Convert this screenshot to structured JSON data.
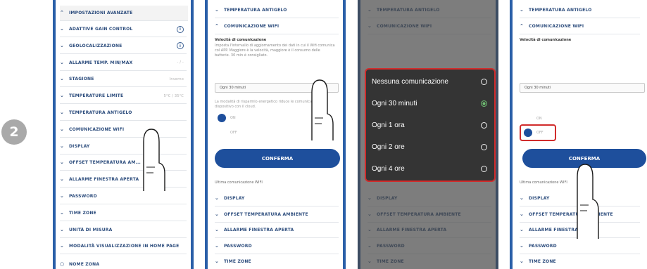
{
  "step_number": "2",
  "screen1": {
    "header": "IMPOSTAZIONI AVANZATE",
    "rows": [
      {
        "label": "ADATTIVE GAIN CONTROL",
        "info": "i"
      },
      {
        "label": "GEOLOCALIZZAZIONE",
        "info": "i"
      },
      {
        "label": "ALLARME TEMP. MIN/MAX",
        "value": "- / -"
      },
      {
        "label": "STAGIONE",
        "value": "Inverno"
      },
      {
        "label": "TEMPERATURE LIMITE",
        "value": "5°C / 35°C"
      },
      {
        "label": "TEMPERATURA ANTIGELO",
        "value": ""
      },
      {
        "label": "COMUNICAZIONE WIFI",
        "value": ""
      },
      {
        "label": "DISPLAY",
        "value": ""
      },
      {
        "label": "OFFSET TEMPERATURA AM...",
        "value": ""
      },
      {
        "label": "ALLARME FINESTRA APERTA",
        "value": ""
      },
      {
        "label": "PASSWORD",
        "value": ""
      },
      {
        "label": "TIME ZONE",
        "value": ""
      },
      {
        "label": "UNITÀ DI MISURA",
        "value": ""
      },
      {
        "label": "MODALITÀ VISUALIZZAZIONE IN HOME PAGE",
        "value": ""
      }
    ],
    "footer": "NOME ZONA"
  },
  "screen2": {
    "row_antigelo": "TEMPERATURA ANTIGELO",
    "row_wifi": "COMUNICAZIONE WIFI",
    "freq_title": "Velocità di comunicazione",
    "freq_desc": "Imposta l'intervallo di aggiornamento dei dati in cui il Wifi comunica col APP. Maggiore è la velocità, maggiore è il consumo delle batterie. 30 min è consigliato.",
    "select_value": "Ogni 30 minuti",
    "toggle_desc": "La modalità di risparmio energetico riduce le comunicazioni del dispositivo con il cloud.",
    "toggle_on": "ON",
    "toggle_off": "OFF",
    "confirm": "CONFERMA",
    "last_comm": "Ultima comunicazione WIFI",
    "rows_below": [
      "DISPLAY",
      "OFFSET TEMPERATURA AMBIENTE",
      "ALLARME FINESTRA APERTA",
      "PASSWORD",
      "TIME ZONE"
    ]
  },
  "screen3": {
    "bg_rows_top": [
      "TEMPERATURA ANTIGELO",
      "COMUNICAZIONE WIFI"
    ],
    "bg_rows_bottom": [
      "DISPLAY",
      "OFFSET TEMPERATURA AMBIENTE",
      "ALLARME FINESTRA APERTA",
      "PASSWORD",
      "TIME ZONE"
    ],
    "options": [
      {
        "label": "Nessuna comunicazione",
        "selected": false
      },
      {
        "label": "Ogni 30 minuti",
        "selected": true
      },
      {
        "label": "Ogni 1 ora",
        "selected": false
      },
      {
        "label": "Ogni 2 ore",
        "selected": false
      },
      {
        "label": "Ogni 4 ore",
        "selected": false
      }
    ]
  },
  "screen4": {
    "row_antigelo": "TEMPERATURA ANTIGELO",
    "row_wifi": "COMUNICAZIONE WIFI",
    "freq_title": "Velocità di comunicazione",
    "select_value": "Ogni 30 minuti",
    "toggle_on": "ON",
    "toggle_off": "OFF",
    "confirm": "CONFERMA",
    "last_comm": "Ultima comunicazione WIFI",
    "rows_below": [
      "DISPLAY",
      "OFFSET TEMPERATURA AMBIENTE",
      "ALLARME FINESTRA APERTA",
      "PASSWORD",
      "TIME ZONE"
    ]
  },
  "colors": {
    "brand_blue": "#1e4f9c",
    "highlight_red": "#d12c2c",
    "selected_green": "#6fbf73"
  }
}
